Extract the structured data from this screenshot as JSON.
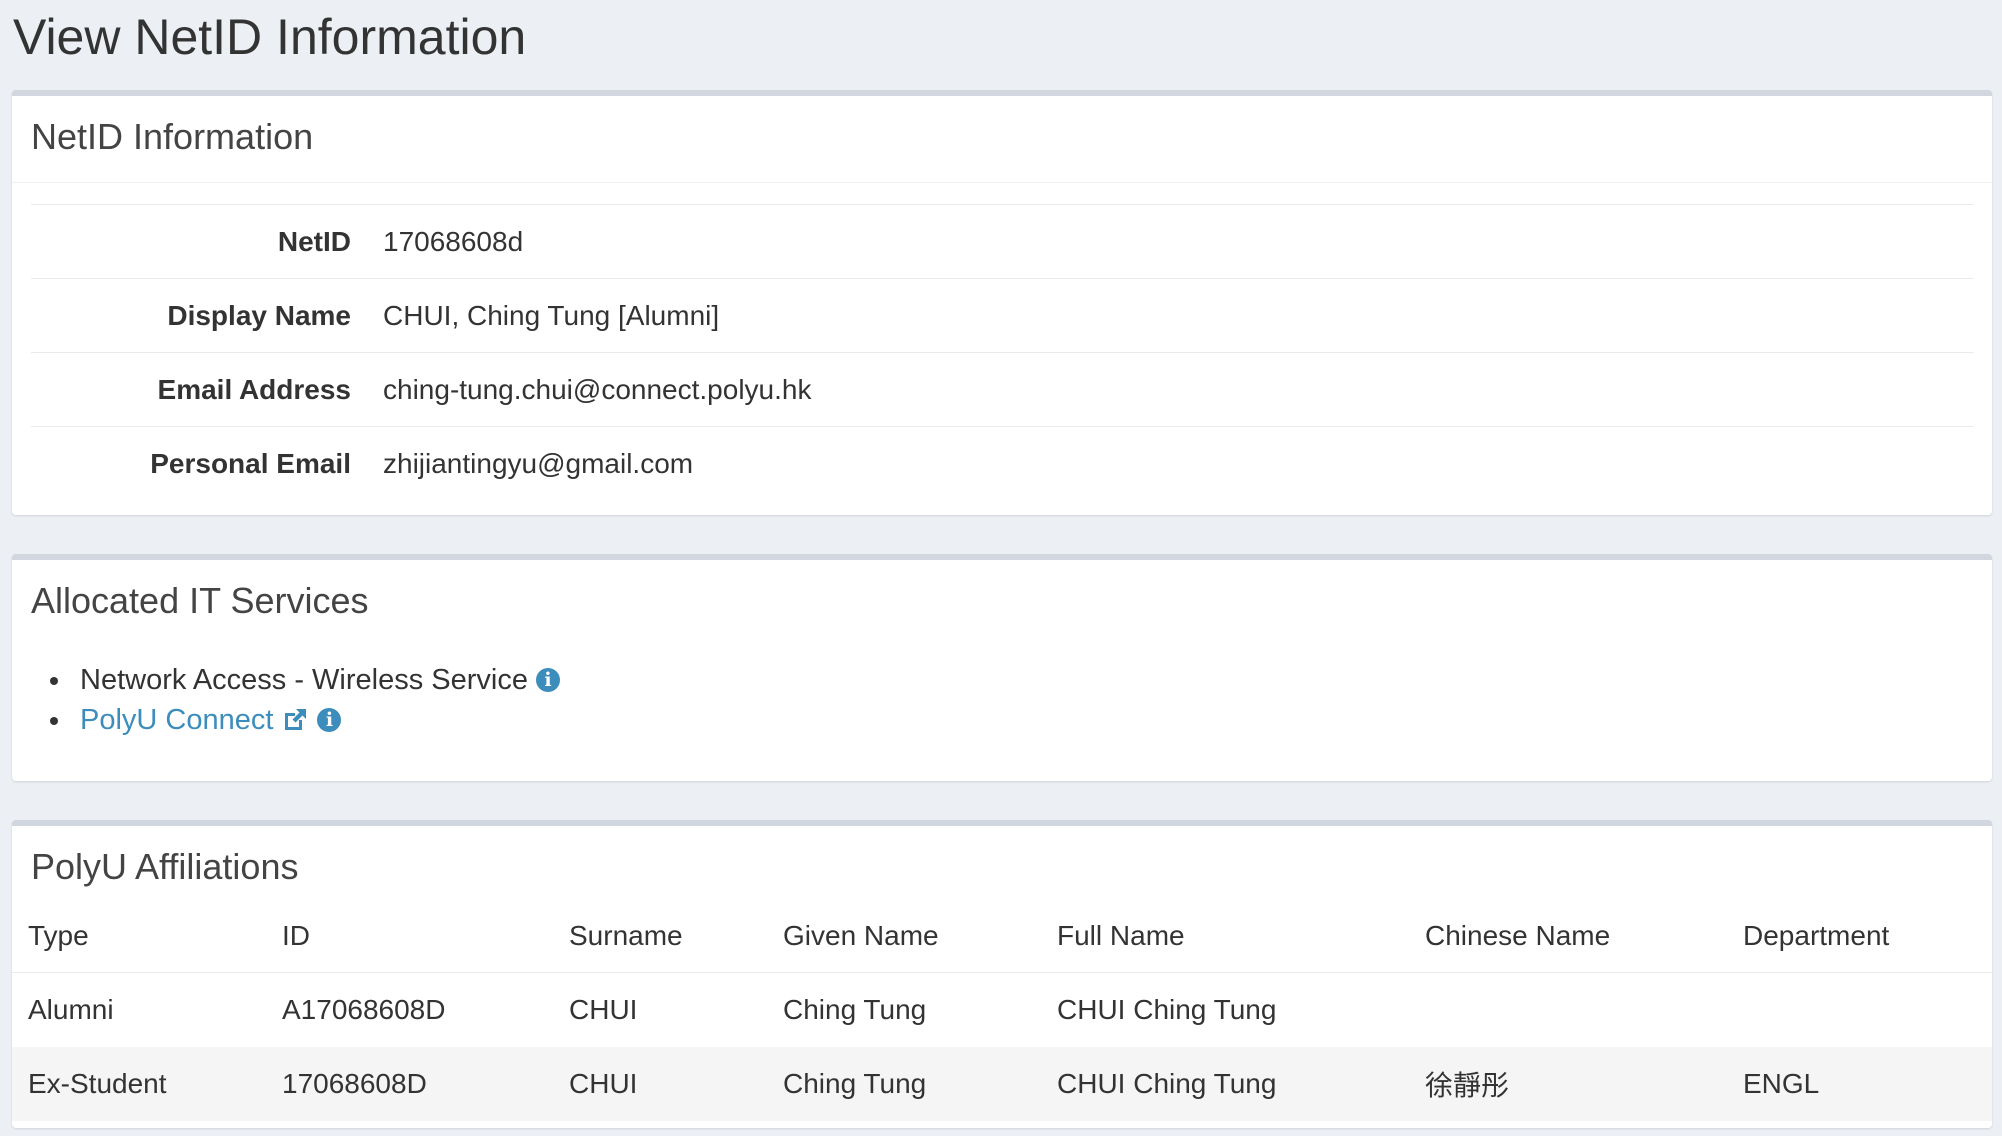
{
  "page_title": "View NetID Information",
  "netid_box": {
    "title": "NetID Information",
    "rows": [
      {
        "label": "NetID",
        "value": "17068608d"
      },
      {
        "label": "Display Name",
        "value": "CHUI, Ching Tung [Alumni]"
      },
      {
        "label": "Email Address",
        "value": "ching-tung.chui@connect.polyu.hk"
      },
      {
        "label": "Personal Email",
        "value": "zhijiantingyu@gmail.com"
      }
    ]
  },
  "services_box": {
    "title": "Allocated IT Services",
    "items": [
      {
        "label": "Network Access - Wireless Service",
        "is_link": false
      },
      {
        "label": "PolyU Connect",
        "is_link": true
      }
    ],
    "link_color": "#3c8dbc"
  },
  "affiliations_box": {
    "title": "PolyU Affiliations",
    "columns": [
      "Type",
      "ID",
      "Surname",
      "Given Name",
      "Full Name",
      "Chinese Name",
      "Department"
    ],
    "rows": [
      [
        "Alumni",
        "A17068608D",
        "CHUI",
        "Ching Tung",
        "CHUI Ching Tung",
        "",
        ""
      ],
      [
        "Ex-Student",
        "17068608D",
        "CHUI",
        "Ching Tung",
        "CHUI Ching Tung",
        "徐靜彤",
        "ENGL"
      ]
    ]
  }
}
